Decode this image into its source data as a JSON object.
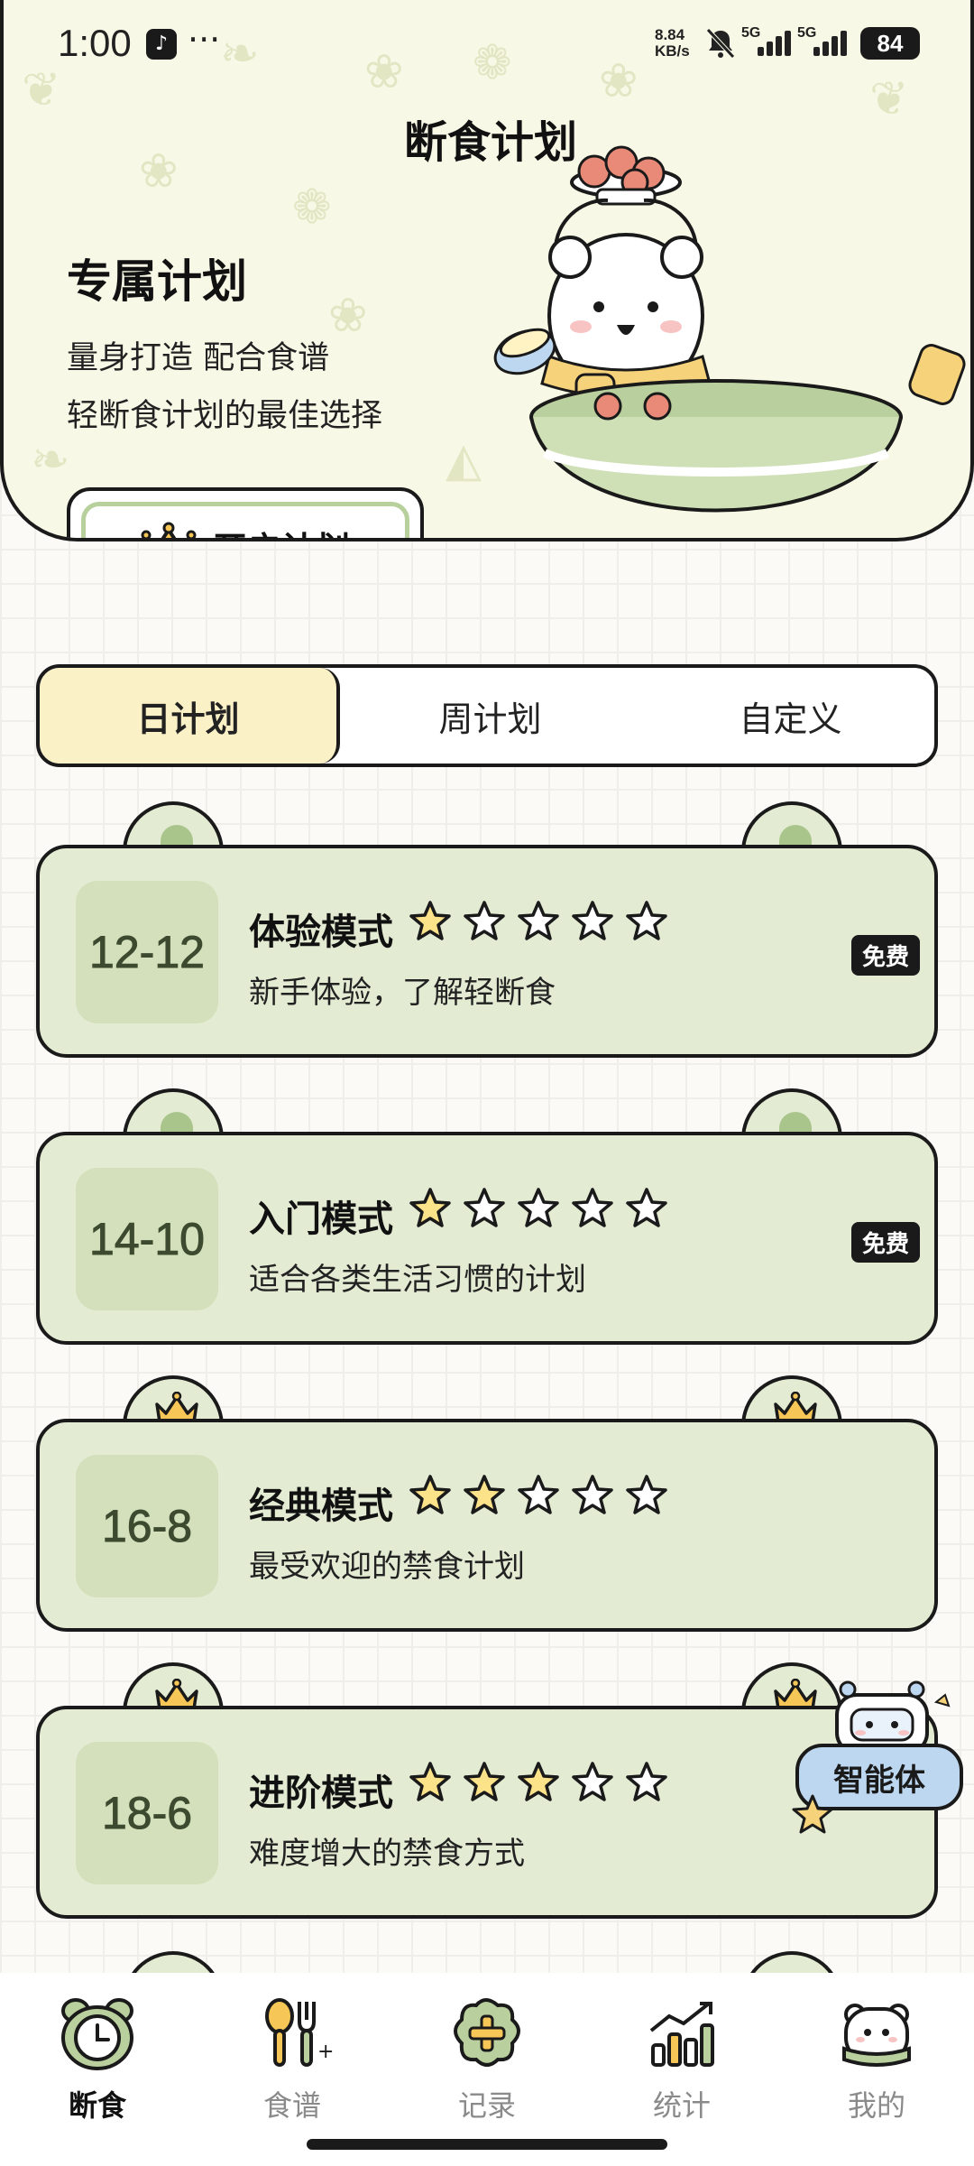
{
  "status_bar": {
    "time": "1:00",
    "network_speed_value": "8.84",
    "network_speed_unit": "KB/s",
    "sim1": "5G",
    "sim2": "5G",
    "battery": "84"
  },
  "header": {
    "title": "断食计划",
    "hero_title": "专属计划",
    "hero_line1": "量身打造 配合食谱",
    "hero_line2": "轻断食计划的最佳选择",
    "start_button": "开启计划"
  },
  "tabs": [
    {
      "label": "日计划",
      "active": true
    },
    {
      "label": "周计划",
      "active": false
    },
    {
      "label": "自定义",
      "active": false
    }
  ],
  "plans": [
    {
      "code": "12-12",
      "name": "体验模式",
      "stars_filled": 1,
      "stars_total": 5,
      "desc": "新手体验，了解轻断食",
      "badge": "免费",
      "premium": false
    },
    {
      "code": "14-10",
      "name": "入门模式",
      "stars_filled": 1,
      "stars_total": 5,
      "desc": "适合各类生活习惯的计划",
      "badge": "免费",
      "premium": false
    },
    {
      "code": "16-8",
      "name": "经典模式",
      "stars_filled": 2,
      "stars_total": 5,
      "desc": "最受欢迎的禁食计划",
      "badge": "",
      "premium": true
    },
    {
      "code": "18-6",
      "name": "进阶模式",
      "stars_filled": 3,
      "stars_total": 5,
      "desc": "难度增大的禁食方式",
      "badge": "",
      "premium": true
    }
  ],
  "agent": {
    "label": "智能体"
  },
  "bottom_nav": [
    {
      "label": "断食",
      "icon": "alarm-clock-icon",
      "active": true
    },
    {
      "label": "食谱",
      "icon": "spoon-fork-icon",
      "active": false
    },
    {
      "label": "记录",
      "icon": "plus-record-icon",
      "active": false
    },
    {
      "label": "统计",
      "icon": "bar-chart-icon",
      "active": false
    },
    {
      "label": "我的",
      "icon": "bear-profile-icon",
      "active": false
    }
  ],
  "colors": {
    "card_bg": "#e3ebd3",
    "code_bg": "#d3e0bb",
    "active_tab": "#fbf1c7",
    "star_fill": "#fce38a",
    "header_bg": "#f8f8e6",
    "accent_green": "#a9c58c"
  }
}
